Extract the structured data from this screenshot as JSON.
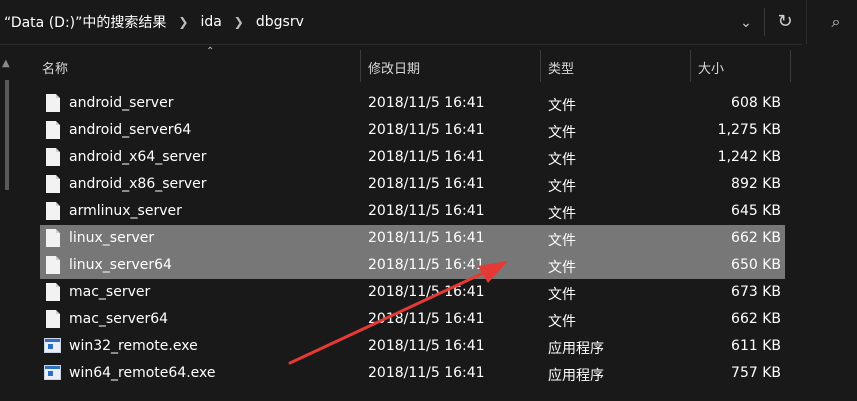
{
  "address": {
    "crumbs": [
      "“Data (D:)”中的搜索结果",
      "ida",
      "dbgsrv"
    ],
    "dropdown_icon": "chevron-down-icon",
    "refresh_icon": "refresh-icon",
    "search_icon": "search-icon"
  },
  "columns": {
    "name": "名称",
    "date": "修改日期",
    "type": "类型",
    "size": "大小"
  },
  "files": [
    {
      "name": "android_server",
      "date": "2018/11/5 16:41",
      "type": "文件",
      "size": "608 KB",
      "icon": "file-icon",
      "selected": false
    },
    {
      "name": "android_server64",
      "date": "2018/11/5 16:41",
      "type": "文件",
      "size": "1,275 KB",
      "icon": "file-icon",
      "selected": false
    },
    {
      "name": "android_x64_server",
      "date": "2018/11/5 16:41",
      "type": "文件",
      "size": "1,242 KB",
      "icon": "file-icon",
      "selected": false
    },
    {
      "name": "android_x86_server",
      "date": "2018/11/5 16:41",
      "type": "文件",
      "size": "892 KB",
      "icon": "file-icon",
      "selected": false
    },
    {
      "name": "armlinux_server",
      "date": "2018/11/5 16:41",
      "type": "文件",
      "size": "645 KB",
      "icon": "file-icon",
      "selected": false
    },
    {
      "name": "linux_server",
      "date": "2018/11/5 16:41",
      "type": "文件",
      "size": "662 KB",
      "icon": "file-icon",
      "selected": true
    },
    {
      "name": "linux_server64",
      "date": "2018/11/5 16:41",
      "type": "文件",
      "size": "650 KB",
      "icon": "file-icon",
      "selected": true
    },
    {
      "name": "mac_server",
      "date": "2018/11/5 16:41",
      "type": "文件",
      "size": "673 KB",
      "icon": "file-icon",
      "selected": false
    },
    {
      "name": "mac_server64",
      "date": "2018/11/5 16:41",
      "type": "文件",
      "size": "662 KB",
      "icon": "file-icon",
      "selected": false
    },
    {
      "name": "win32_remote.exe",
      "date": "2018/11/5 16:41",
      "type": "应用程序",
      "size": "611 KB",
      "icon": "exe-icon",
      "selected": false
    },
    {
      "name": "win64_remote64.exe",
      "date": "2018/11/5 16:41",
      "type": "应用程序",
      "size": "757 KB",
      "icon": "exe-icon",
      "selected": false
    }
  ],
  "colors": {
    "background": "#191919",
    "selection": "#777777",
    "annotation_arrow": "#e53935"
  }
}
